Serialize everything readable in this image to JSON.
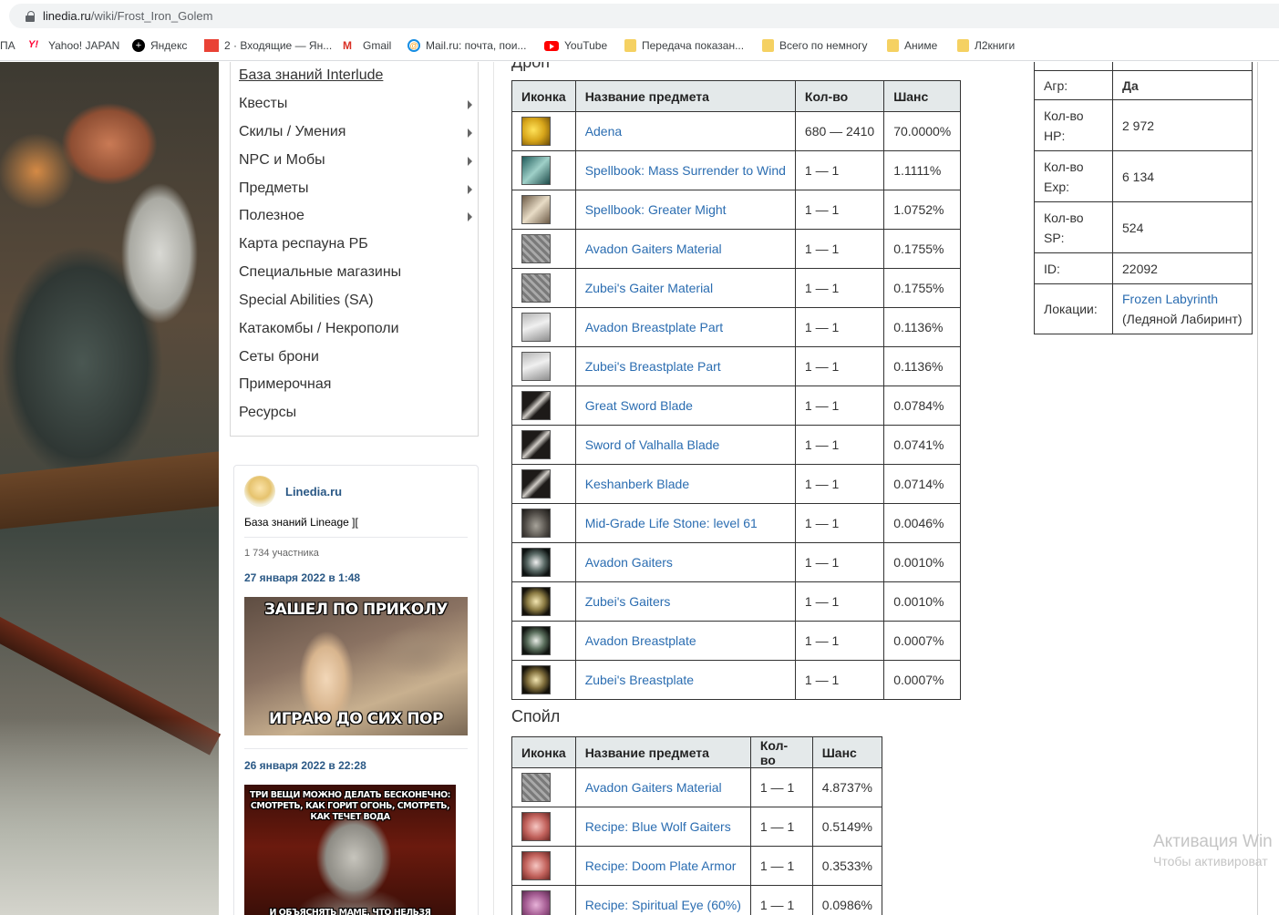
{
  "browser": {
    "url_host": "linedia.ru",
    "url_path": "/wiki/Frost_Iron_Golem",
    "bookmarks": [
      {
        "label": "ПА",
        "icon": "none"
      },
      {
        "label": "Yahoo! JAPAN",
        "icon": "yahoo-icon"
      },
      {
        "label": "Яндекс",
        "icon": "yandex-icon"
      },
      {
        "label": "2 · Входящие — Ян...",
        "icon": "mail-icon"
      },
      {
        "label": "Gmail",
        "icon": "gmail-icon"
      },
      {
        "label": "Mail.ru: почта, пои...",
        "icon": "mailru-icon"
      },
      {
        "label": "YouTube",
        "icon": "youtube-icon"
      },
      {
        "label": "Передача показан...",
        "icon": "folder-icon"
      },
      {
        "label": "Всего по немногу",
        "icon": "folder-icon"
      },
      {
        "label": "Аниме",
        "icon": "folder-icon"
      },
      {
        "label": "Л2книги",
        "icon": "folder-icon"
      }
    ]
  },
  "menu": {
    "items": [
      {
        "label": "База знаний Interlude",
        "has_arrow": false
      },
      {
        "label": "Квесты",
        "has_arrow": true
      },
      {
        "label": "Скилы / Умения",
        "has_arrow": true
      },
      {
        "label": "NPC и Мобы",
        "has_arrow": true
      },
      {
        "label": "Предметы",
        "has_arrow": true
      },
      {
        "label": "Полезное",
        "has_arrow": true
      },
      {
        "label": "Карта респауна РБ",
        "has_arrow": false
      },
      {
        "label": "Специальные магазины",
        "has_arrow": false
      },
      {
        "label": "Special Abilities (SA)",
        "has_arrow": false
      },
      {
        "label": "Катакомбы / Некрополи",
        "has_arrow": false
      },
      {
        "label": "Сеты брони",
        "has_arrow": false
      },
      {
        "label": "Примерочная",
        "has_arrow": false
      },
      {
        "label": "Ресурсы",
        "has_arrow": false
      }
    ]
  },
  "vk": {
    "name": "Linedia.ru",
    "description": "База знаний Lineage ][",
    "members": "1 734 участника",
    "posts": [
      {
        "date": "27 января 2022 в 1:48",
        "meme_top": "ЗАШЕЛ ПО ПРИКОЛУ",
        "meme_bottom": "ИГРАЮ ДО СИХ ПОР"
      },
      {
        "date": "26 января 2022 в 22:28",
        "meme_top": "ТРИ ВЕЩИ МОЖНО ДЕЛАТЬ БЕСКОНЕЧНО: СМОТРЕТЬ, КАК ГОРИТ ОГОНЬ, СМОТРЕТЬ, КАК ТЕЧЕТ ВОДА",
        "meme_bottom": "И ОБЪЯСНЯТЬ МАМЕ, ЧТО НЕЛЬЗЯ ПОСТАВИТЬ НА ПАУЗУ"
      }
    ]
  },
  "drop": {
    "title": "Дроп",
    "headers": [
      "Иконка",
      "Название предмета",
      "Кол-во",
      "Шанс"
    ],
    "rows": [
      {
        "icon": "adena-icon",
        "name": "Adena",
        "qty": "680 — 2410",
        "chance": "70.0000%"
      },
      {
        "icon": "spellbook-icon",
        "name": "Spellbook: Mass Surrender to Wind",
        "qty": "1 — 1",
        "chance": "1.1111%"
      },
      {
        "icon": "spellbook-icon",
        "name": "Spellbook: Greater Might",
        "qty": "1 — 1",
        "chance": "1.0752%"
      },
      {
        "icon": "material-icon",
        "name": "Avadon Gaiters Material",
        "qty": "1 — 1",
        "chance": "0.1755%"
      },
      {
        "icon": "material-icon",
        "name": "Zubei's Gaiter Material",
        "qty": "1 — 1",
        "chance": "0.1755%"
      },
      {
        "icon": "part-icon",
        "name": "Avadon Breastplate Part",
        "qty": "1 — 1",
        "chance": "0.1136%"
      },
      {
        "icon": "part-icon",
        "name": "Zubei's Breastplate Part",
        "qty": "1 — 1",
        "chance": "0.1136%"
      },
      {
        "icon": "blade-icon",
        "name": "Great Sword Blade",
        "qty": "1 — 1",
        "chance": "0.0784%"
      },
      {
        "icon": "blade-icon",
        "name": "Sword of Valhalla Blade",
        "qty": "1 — 1",
        "chance": "0.0741%"
      },
      {
        "icon": "blade-icon",
        "name": "Keshanberk Blade",
        "qty": "1 — 1",
        "chance": "0.0714%"
      },
      {
        "icon": "life-stone-icon",
        "name": "Mid-Grade Life Stone: level 61",
        "qty": "1 — 1",
        "chance": "0.0046%"
      },
      {
        "icon": "gaiters-icon",
        "name": "Avadon Gaiters",
        "qty": "1 — 1",
        "chance": "0.0010%"
      },
      {
        "icon": "gaiters-icon",
        "name": "Zubei's Gaiters",
        "qty": "1 — 1",
        "chance": "0.0010%"
      },
      {
        "icon": "breastplate-icon",
        "name": "Avadon Breastplate",
        "qty": "1 — 1",
        "chance": "0.0007%"
      },
      {
        "icon": "breastplate-icon",
        "name": "Zubei's Breastplate",
        "qty": "1 — 1",
        "chance": "0.0007%"
      }
    ]
  },
  "spoil": {
    "title": "Спойл",
    "headers": [
      "Иконка",
      "Название предмета",
      "Кол-во",
      "Шанс"
    ],
    "rows": [
      {
        "icon": "material-icon",
        "name": "Avadon Gaiters Material",
        "qty": "1 — 1",
        "chance": "4.8737%"
      },
      {
        "icon": "recipe-icon",
        "name": "Recipe: Blue Wolf Gaiters",
        "qty": "1 — 1",
        "chance": "0.5149%"
      },
      {
        "icon": "recipe-icon",
        "name": "Recipe: Doom Plate Armor",
        "qty": "1 — 1",
        "chance": "0.3533%"
      },
      {
        "icon": "recipe-icon",
        "name": "Recipe: Spiritual Eye (60%)",
        "qty": "1 — 1",
        "chance": "0.0986%"
      }
    ]
  },
  "info": {
    "agr_label": "Агр:",
    "agr_value": "Да",
    "hp_label": "Кол-во HP:",
    "hp_value": "2 972",
    "exp_label": "Кол-во Exp:",
    "exp_value": "6 134",
    "sp_label": "Кол-во SP:",
    "sp_value": "524",
    "id_label": "ID:",
    "id_value": "22092",
    "loc_label": "Локации:",
    "loc_link": "Frozen Labyrinth",
    "loc_note": "(Ледяной Лабиринт)"
  },
  "watermark": {
    "line1": "Активация Win",
    "line2": "Чтобы активироват"
  }
}
